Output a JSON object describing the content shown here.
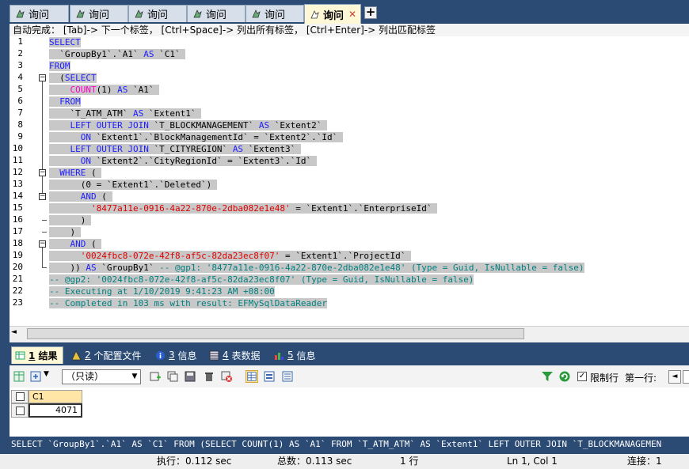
{
  "tabs": [
    {
      "label": "询问"
    },
    {
      "label": "询问"
    },
    {
      "label": "询问"
    },
    {
      "label": "询问"
    },
    {
      "label": "询问"
    },
    {
      "label": "询问",
      "active": true
    }
  ],
  "tab_close_glyph": "✕",
  "add_tab_glyph": "+",
  "autocomplete_hint": "自动完成： [Tab]-> 下一个标签， [Ctrl+Space]-> 列出所有标签， [Ctrl+Enter]-> 列出匹配标签",
  "line_numbers": [
    "1",
    "2",
    "3",
    "4",
    "5",
    "6",
    "7",
    "8",
    "9",
    "10",
    "11",
    "12",
    "13",
    "14",
    "15",
    "16",
    "17",
    "18",
    "19",
    "20",
    "21",
    "22",
    "23"
  ],
  "code_lines": [
    [
      {
        "t": "SELECT",
        "c": "kw"
      }
    ],
    [
      {
        "t": "  `GroupBy1`.`A1` ",
        "c": "tx"
      },
      {
        "t": "AS",
        "c": "kw"
      },
      {
        "t": " `C1` ",
        "c": "tx"
      }
    ],
    [
      {
        "t": "FROM",
        "c": "kw"
      }
    ],
    [
      {
        "t": "  (",
        "c": "tx"
      },
      {
        "t": "SELECT",
        "c": "kw"
      }
    ],
    [
      {
        "t": "    ",
        "c": "tx"
      },
      {
        "t": "COUNT",
        "c": "fn"
      },
      {
        "t": "(1) ",
        "c": "tx"
      },
      {
        "t": "AS",
        "c": "kw"
      },
      {
        "t": " `A1` ",
        "c": "tx"
      }
    ],
    [
      {
        "t": "  ",
        "c": "tx"
      },
      {
        "t": "FROM",
        "c": "kw"
      }
    ],
    [
      {
        "t": "    `T_ATM_ATM` ",
        "c": "tx"
      },
      {
        "t": "AS",
        "c": "kw"
      },
      {
        "t": " `Extent1` ",
        "c": "tx"
      }
    ],
    [
      {
        "t": "    ",
        "c": "tx"
      },
      {
        "t": "LEFT OUTER JOIN",
        "c": "kw"
      },
      {
        "t": " `T_BLOCKMANAGEMENT` ",
        "c": "tx"
      },
      {
        "t": "AS",
        "c": "kw"
      },
      {
        "t": " `Extent2` ",
        "c": "tx"
      }
    ],
    [
      {
        "t": "      ",
        "c": "tx"
      },
      {
        "t": "ON",
        "c": "kw"
      },
      {
        "t": " `Extent1`.`BlockManagementId` = `Extent2`.`Id` ",
        "c": "tx"
      }
    ],
    [
      {
        "t": "    ",
        "c": "tx"
      },
      {
        "t": "LEFT OUTER JOIN",
        "c": "kw"
      },
      {
        "t": " `T_CITYREGION` ",
        "c": "tx"
      },
      {
        "t": "AS",
        "c": "kw"
      },
      {
        "t": " `Extent3` ",
        "c": "tx"
      }
    ],
    [
      {
        "t": "      ",
        "c": "tx"
      },
      {
        "t": "ON",
        "c": "kw"
      },
      {
        "t": " `Extent2`.`CityRegionId` = `Extent3`.`Id` ",
        "c": "tx"
      }
    ],
    [
      {
        "t": "  ",
        "c": "tx"
      },
      {
        "t": "WHERE",
        "c": "kw"
      },
      {
        "t": " ( ",
        "c": "tx"
      }
    ],
    [
      {
        "t": "      (0 = `Extent1`.`Deleted`) ",
        "c": "tx"
      }
    ],
    [
      {
        "t": "      ",
        "c": "tx"
      },
      {
        "t": "AND",
        "c": "kw"
      },
      {
        "t": " ( ",
        "c": "tx"
      }
    ],
    [
      {
        "t": "        ",
        "c": "tx"
      },
      {
        "t": "'8477a11e-0916-4a22-870e-2dba082e1e48'",
        "c": "str"
      },
      {
        "t": " = `Extent1`.`EnterpriseId` ",
        "c": "tx"
      }
    ],
    [
      {
        "t": "      ) ",
        "c": "tx"
      }
    ],
    [
      {
        "t": "    ) ",
        "c": "tx"
      }
    ],
    [
      {
        "t": "    ",
        "c": "tx"
      },
      {
        "t": "AND",
        "c": "kw"
      },
      {
        "t": " ( ",
        "c": "tx"
      }
    ],
    [
      {
        "t": "      ",
        "c": "tx"
      },
      {
        "t": "'0024fbc8-072e-42f8-af5c-82da23ec8f07'",
        "c": "str"
      },
      {
        "t": " = `Extent1`.`ProjectId` ",
        "c": "tx"
      }
    ],
    [
      {
        "t": "    )) ",
        "c": "tx"
      },
      {
        "t": "AS",
        "c": "kw"
      },
      {
        "t": " `GroupBy1` ",
        "c": "tx"
      },
      {
        "t": "-- @gp1: '8477a11e-0916-4a22-870e-2dba082e1e48' (Type = Guid, IsNullable = false)",
        "c": "cm"
      }
    ],
    [
      {
        "t": "-- @gp2: '0024fbc8-072e-42f8-af5c-82da23ec8f07' (Type = Guid, IsNullable = false)",
        "c": "cm"
      }
    ],
    [
      {
        "t": "-- Executing at 1/10/2019 9:41:23 AM +08:00",
        "c": "cm"
      }
    ],
    [
      {
        "t": "-- Completed in 103 ms with result: EFMySqlDataReader",
        "c": "cm"
      }
    ]
  ],
  "result_tabs": [
    {
      "num": "1",
      "label": "结果",
      "active": true
    },
    {
      "num": "2",
      "label": "个配置文件"
    },
    {
      "num": "3",
      "label": "信息"
    },
    {
      "num": "4",
      "label": "表数据"
    },
    {
      "num": "5",
      "label": "信息"
    }
  ],
  "toolbar": {
    "readonly_value": "（只读）",
    "limit_rows_label": "限制行",
    "first_row_label": "第一行:"
  },
  "grid": {
    "columns": [
      "C1"
    ],
    "rows": [
      [
        "4071"
      ]
    ]
  },
  "sql_preview": "SELECT `GroupBy1`.`A1` AS `C1` FROM (SELECT COUNT(1) AS `A1` FROM `T_ATM_ATM` AS `Extent1` LEFT OUTER JOIN `T_BLOCKMANAGEMEN",
  "status": {
    "exec": "执行：0.112 sec",
    "total": "总数：0.113 sec",
    "rows": "1 行",
    "position": "Ln 1, Col 1",
    "connections": "连接：1"
  },
  "colors": {
    "keyword": "#2020ff",
    "function": "#ff00c8",
    "string": "#e00000",
    "comment": "#008080",
    "selection": "#c8c8c8",
    "chrome": "#2b4b75"
  }
}
